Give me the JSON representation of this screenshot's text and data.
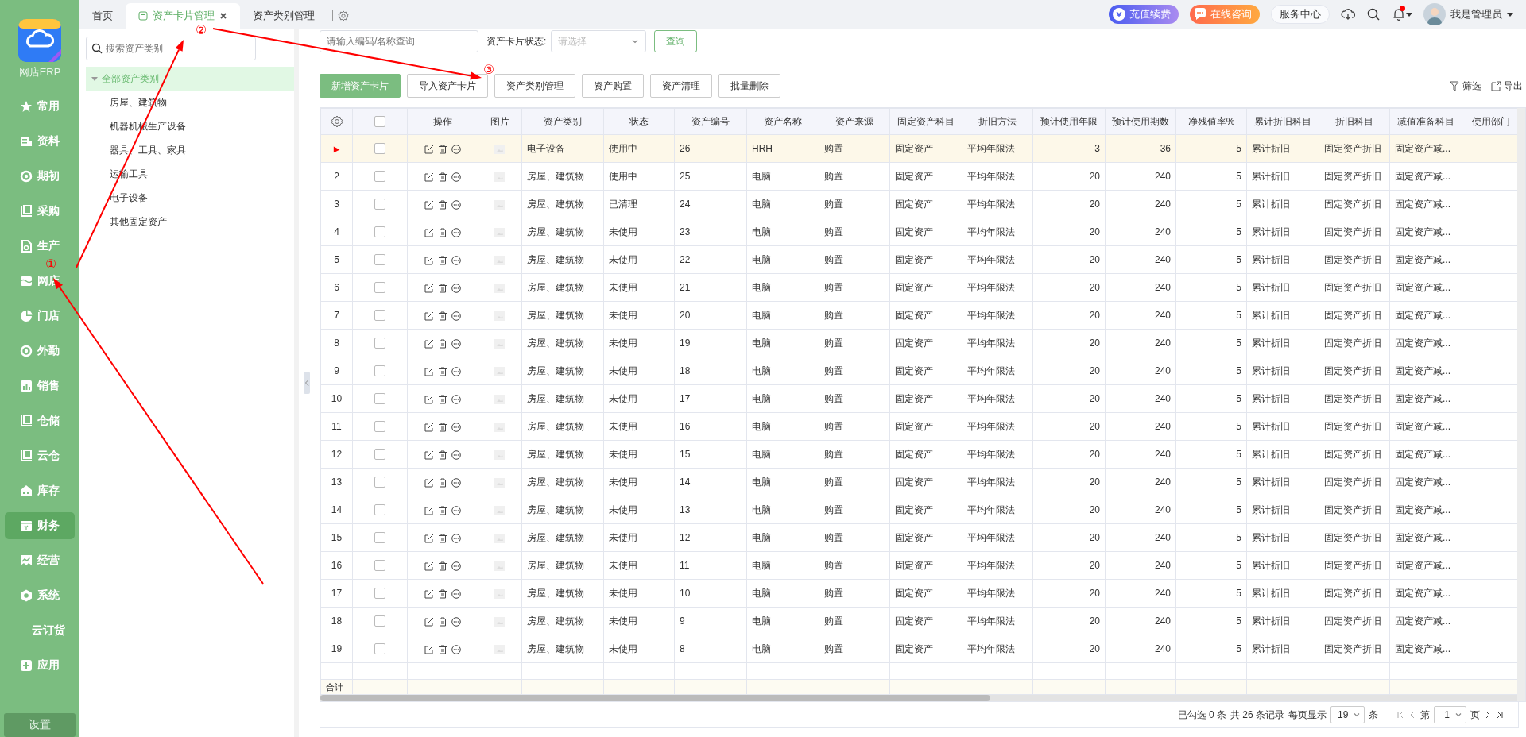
{
  "sidebar": {
    "app_name": "网店ERP",
    "items": [
      {
        "label": "常用",
        "selected": false
      },
      {
        "label": "资料",
        "selected": false
      },
      {
        "label": "期初",
        "selected": false
      },
      {
        "label": "采购",
        "selected": false
      },
      {
        "label": "生产",
        "selected": false
      },
      {
        "label": "网店",
        "selected": false
      },
      {
        "label": "门店",
        "selected": false
      },
      {
        "label": "外勤",
        "selected": false
      },
      {
        "label": "销售",
        "selected": false
      },
      {
        "label": "仓储",
        "selected": false
      },
      {
        "label": "云仓",
        "selected": false
      },
      {
        "label": "库存",
        "selected": false
      },
      {
        "label": "财务",
        "selected": true
      },
      {
        "label": "经营",
        "selected": false
      },
      {
        "label": "系统",
        "selected": false
      },
      {
        "label": "云订货",
        "selected": false
      },
      {
        "label": "应用",
        "selected": false
      }
    ],
    "settings": "设置"
  },
  "tabs": [
    {
      "label": "首页",
      "selected": false,
      "closable": false
    },
    {
      "label": "资产卡片管理",
      "selected": true,
      "closable": true
    },
    {
      "label": "资产类别管理",
      "selected": false,
      "closable": false
    }
  ],
  "header": {
    "recharge": "充值续费",
    "consult": "在线咨询",
    "service": "服务中心",
    "notification_dot": true,
    "user": "我是管理员"
  },
  "tree": {
    "search_placeholder": "搜索资产类别",
    "root": {
      "label": "全部资产类别",
      "selected": true,
      "expanded": true,
      "children": [
        {
          "label": "房屋、建筑物",
          "selected": false
        },
        {
          "label": "机器机械生产设备",
          "selected": false
        },
        {
          "label": "器具、工具、家具",
          "selected": false
        },
        {
          "label": "运输工具",
          "selected": false
        },
        {
          "label": "电子设备",
          "selected": false
        },
        {
          "label": "其他固定资产",
          "selected": false
        }
      ]
    }
  },
  "filter": {
    "keyword_placeholder": "请输入编码/名称查询",
    "status_label": "资产卡片状态:",
    "status_placeholder": "请选择",
    "query": "查询"
  },
  "toolbar": {
    "buttons": [
      {
        "label": "新增资产卡片",
        "primary": true
      },
      {
        "label": "导入资产卡片",
        "primary": false
      },
      {
        "label": "资产类别管理",
        "primary": false
      },
      {
        "label": "资产购置",
        "primary": false
      },
      {
        "label": "资产清理",
        "primary": false
      },
      {
        "label": "批量删除",
        "primary": false
      }
    ],
    "filter_link": "筛选",
    "export_link": "导出"
  },
  "table": {
    "all_checked": false,
    "columns": [
      {
        "label": "操作",
        "kind": "actions"
      },
      {
        "label": "图片",
        "kind": "image"
      },
      {
        "label": "资产类别",
        "kind": "text"
      },
      {
        "label": "状态",
        "kind": "text"
      },
      {
        "label": "资产编号",
        "kind": "text"
      },
      {
        "label": "资产名称",
        "kind": "text"
      },
      {
        "label": "资产来源",
        "kind": "text"
      },
      {
        "label": "固定资产科目",
        "kind": "text"
      },
      {
        "label": "折旧方法",
        "kind": "text"
      },
      {
        "label": "预计使用年限",
        "kind": "number"
      },
      {
        "label": "预计使用期数",
        "kind": "number"
      },
      {
        "label": "净残值率%",
        "kind": "number"
      },
      {
        "label": "累计折旧科目",
        "kind": "text"
      },
      {
        "label": "折旧科目",
        "kind": "text"
      },
      {
        "label": "减值准备科目",
        "kind": "text"
      },
      {
        "label": "使用部门",
        "kind": "text"
      }
    ],
    "rows": [
      {
        "index": "▶",
        "selected": true,
        "checked": false,
        "cells": [
          "",
          "",
          "电子设备",
          "使用中",
          "26",
          "HRH",
          "购置",
          "固定资产",
          "平均年限法",
          "3",
          "36",
          "5",
          "累计折旧",
          "固定资产折旧",
          "固定资产减...",
          ""
        ]
      },
      {
        "index": "2",
        "selected": false,
        "checked": false,
        "cells": [
          "",
          "",
          "房屋、建筑物",
          "使用中",
          "25",
          "电脑",
          "购置",
          "固定资产",
          "平均年限法",
          "20",
          "240",
          "5",
          "累计折旧",
          "固定资产折旧",
          "固定资产减...",
          ""
        ]
      },
      {
        "index": "3",
        "selected": false,
        "checked": false,
        "cells": [
          "",
          "",
          "房屋、建筑物",
          "已清理",
          "24",
          "电脑",
          "购置",
          "固定资产",
          "平均年限法",
          "20",
          "240",
          "5",
          "累计折旧",
          "固定资产折旧",
          "固定资产减...",
          ""
        ]
      },
      {
        "index": "4",
        "selected": false,
        "checked": false,
        "cells": [
          "",
          "",
          "房屋、建筑物",
          "未使用",
          "23",
          "电脑",
          "购置",
          "固定资产",
          "平均年限法",
          "20",
          "240",
          "5",
          "累计折旧",
          "固定资产折旧",
          "固定资产减...",
          ""
        ]
      },
      {
        "index": "5",
        "selected": false,
        "checked": false,
        "cells": [
          "",
          "",
          "房屋、建筑物",
          "未使用",
          "22",
          "电脑",
          "购置",
          "固定资产",
          "平均年限法",
          "20",
          "240",
          "5",
          "累计折旧",
          "固定资产折旧",
          "固定资产减...",
          ""
        ]
      },
      {
        "index": "6",
        "selected": false,
        "checked": false,
        "cells": [
          "",
          "",
          "房屋、建筑物",
          "未使用",
          "21",
          "电脑",
          "购置",
          "固定资产",
          "平均年限法",
          "20",
          "240",
          "5",
          "累计折旧",
          "固定资产折旧",
          "固定资产减...",
          ""
        ]
      },
      {
        "index": "7",
        "selected": false,
        "checked": false,
        "cells": [
          "",
          "",
          "房屋、建筑物",
          "未使用",
          "20",
          "电脑",
          "购置",
          "固定资产",
          "平均年限法",
          "20",
          "240",
          "5",
          "累计折旧",
          "固定资产折旧",
          "固定资产减...",
          ""
        ]
      },
      {
        "index": "8",
        "selected": false,
        "checked": false,
        "cells": [
          "",
          "",
          "房屋、建筑物",
          "未使用",
          "19",
          "电脑",
          "购置",
          "固定资产",
          "平均年限法",
          "20",
          "240",
          "5",
          "累计折旧",
          "固定资产折旧",
          "固定资产减...",
          ""
        ]
      },
      {
        "index": "9",
        "selected": false,
        "checked": false,
        "cells": [
          "",
          "",
          "房屋、建筑物",
          "未使用",
          "18",
          "电脑",
          "购置",
          "固定资产",
          "平均年限法",
          "20",
          "240",
          "5",
          "累计折旧",
          "固定资产折旧",
          "固定资产减...",
          ""
        ]
      },
      {
        "index": "10",
        "selected": false,
        "checked": false,
        "cells": [
          "",
          "",
          "房屋、建筑物",
          "未使用",
          "17",
          "电脑",
          "购置",
          "固定资产",
          "平均年限法",
          "20",
          "240",
          "5",
          "累计折旧",
          "固定资产折旧",
          "固定资产减...",
          ""
        ]
      },
      {
        "index": "11",
        "selected": false,
        "checked": false,
        "cells": [
          "",
          "",
          "房屋、建筑物",
          "未使用",
          "16",
          "电脑",
          "购置",
          "固定资产",
          "平均年限法",
          "20",
          "240",
          "5",
          "累计折旧",
          "固定资产折旧",
          "固定资产减...",
          ""
        ]
      },
      {
        "index": "12",
        "selected": false,
        "checked": false,
        "cells": [
          "",
          "",
          "房屋、建筑物",
          "未使用",
          "15",
          "电脑",
          "购置",
          "固定资产",
          "平均年限法",
          "20",
          "240",
          "5",
          "累计折旧",
          "固定资产折旧",
          "固定资产减...",
          ""
        ]
      },
      {
        "index": "13",
        "selected": false,
        "checked": false,
        "cells": [
          "",
          "",
          "房屋、建筑物",
          "未使用",
          "14",
          "电脑",
          "购置",
          "固定资产",
          "平均年限法",
          "20",
          "240",
          "5",
          "累计折旧",
          "固定资产折旧",
          "固定资产减...",
          ""
        ]
      },
      {
        "index": "14",
        "selected": false,
        "checked": false,
        "cells": [
          "",
          "",
          "房屋、建筑物",
          "未使用",
          "13",
          "电脑",
          "购置",
          "固定资产",
          "平均年限法",
          "20",
          "240",
          "5",
          "累计折旧",
          "固定资产折旧",
          "固定资产减...",
          ""
        ]
      },
      {
        "index": "15",
        "selected": false,
        "checked": false,
        "cells": [
          "",
          "",
          "房屋、建筑物",
          "未使用",
          "12",
          "电脑",
          "购置",
          "固定资产",
          "平均年限法",
          "20",
          "240",
          "5",
          "累计折旧",
          "固定资产折旧",
          "固定资产减...",
          ""
        ]
      },
      {
        "index": "16",
        "selected": false,
        "checked": false,
        "cells": [
          "",
          "",
          "房屋、建筑物",
          "未使用",
          "11",
          "电脑",
          "购置",
          "固定资产",
          "平均年限法",
          "20",
          "240",
          "5",
          "累计折旧",
          "固定资产折旧",
          "固定资产减...",
          ""
        ]
      },
      {
        "index": "17",
        "selected": false,
        "checked": false,
        "cells": [
          "",
          "",
          "房屋、建筑物",
          "未使用",
          "10",
          "电脑",
          "购置",
          "固定资产",
          "平均年限法",
          "20",
          "240",
          "5",
          "累计折旧",
          "固定资产折旧",
          "固定资产减...",
          ""
        ]
      },
      {
        "index": "18",
        "selected": false,
        "checked": false,
        "cells": [
          "",
          "",
          "房屋、建筑物",
          "未使用",
          "9",
          "电脑",
          "购置",
          "固定资产",
          "平均年限法",
          "20",
          "240",
          "5",
          "累计折旧",
          "固定资产折旧",
          "固定资产减...",
          ""
        ]
      },
      {
        "index": "19",
        "selected": false,
        "checked": false,
        "cells": [
          "",
          "",
          "房屋、建筑物",
          "未使用",
          "8",
          "电脑",
          "购置",
          "固定资产",
          "平均年限法",
          "20",
          "240",
          "5",
          "累计折旧",
          "固定资产折旧",
          "固定资产减...",
          ""
        ]
      }
    ],
    "total_label": "合计"
  },
  "pagination": {
    "selected_info": "已勾选 0 条",
    "total": "共 26 条记录",
    "per_page_label": "每页显示",
    "per_page": "19",
    "per_page_unit": "条",
    "page_prefix": "第",
    "page": "1",
    "page_suffix": "页"
  },
  "annotations": [
    {
      "label": "①"
    },
    {
      "label": "②"
    },
    {
      "label": "③"
    }
  ]
}
